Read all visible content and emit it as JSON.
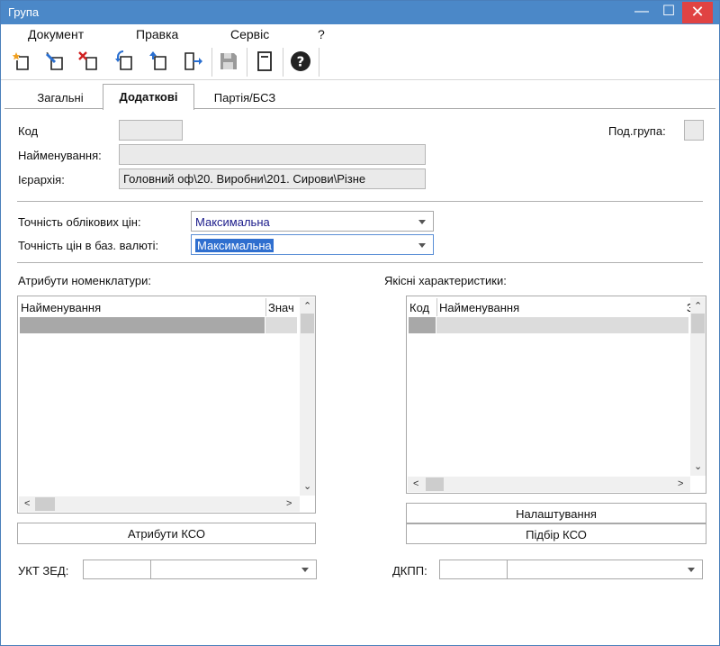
{
  "window": {
    "title": "Група",
    "minimize": "—",
    "maximize": "☐",
    "close": "✕"
  },
  "menu": [
    "Документ",
    "Правка",
    "Сервіс",
    "?"
  ],
  "toolbar": {
    "icons": [
      "new-icon",
      "edit-icon",
      "delete-icon",
      "copy-icon",
      "insert-icon",
      "exit-icon",
      "save-icon",
      "document-icon",
      "help-icon"
    ]
  },
  "tabs": [
    "Загальні",
    "Додаткові",
    "Партія/БСЗ"
  ],
  "form": {
    "code_label": "Код",
    "code_value": "",
    "subgroup_label": "Под.група:",
    "name_label": "Найменування:",
    "name_value": "",
    "hierarchy_label": "Ієрархія:",
    "hierarchy_value": "Головний оф\\20. Виробни\\201. Сирови\\Різне",
    "precision_label": "Точність облікових цін:",
    "precision_value": "Максимальна",
    "base_precision_label": "Точність цін в баз. валюті:",
    "base_precision_value": "Максимальна"
  },
  "attributes": {
    "label": "Атрибути номенклатури:",
    "col_name": "Найменування",
    "col_value": "Знач",
    "button": "Атрибути КСО"
  },
  "qualities": {
    "label": "Якісні характеристики:",
    "col_code": "Код",
    "col_name": "Найменування",
    "col_extra": "З",
    "button_settings": "Налаштування",
    "button_select": "Підбір КСО"
  },
  "bottom": {
    "ukt_label": "УКТ ЗЕД:",
    "dkpp_label": "ДКПП:"
  }
}
